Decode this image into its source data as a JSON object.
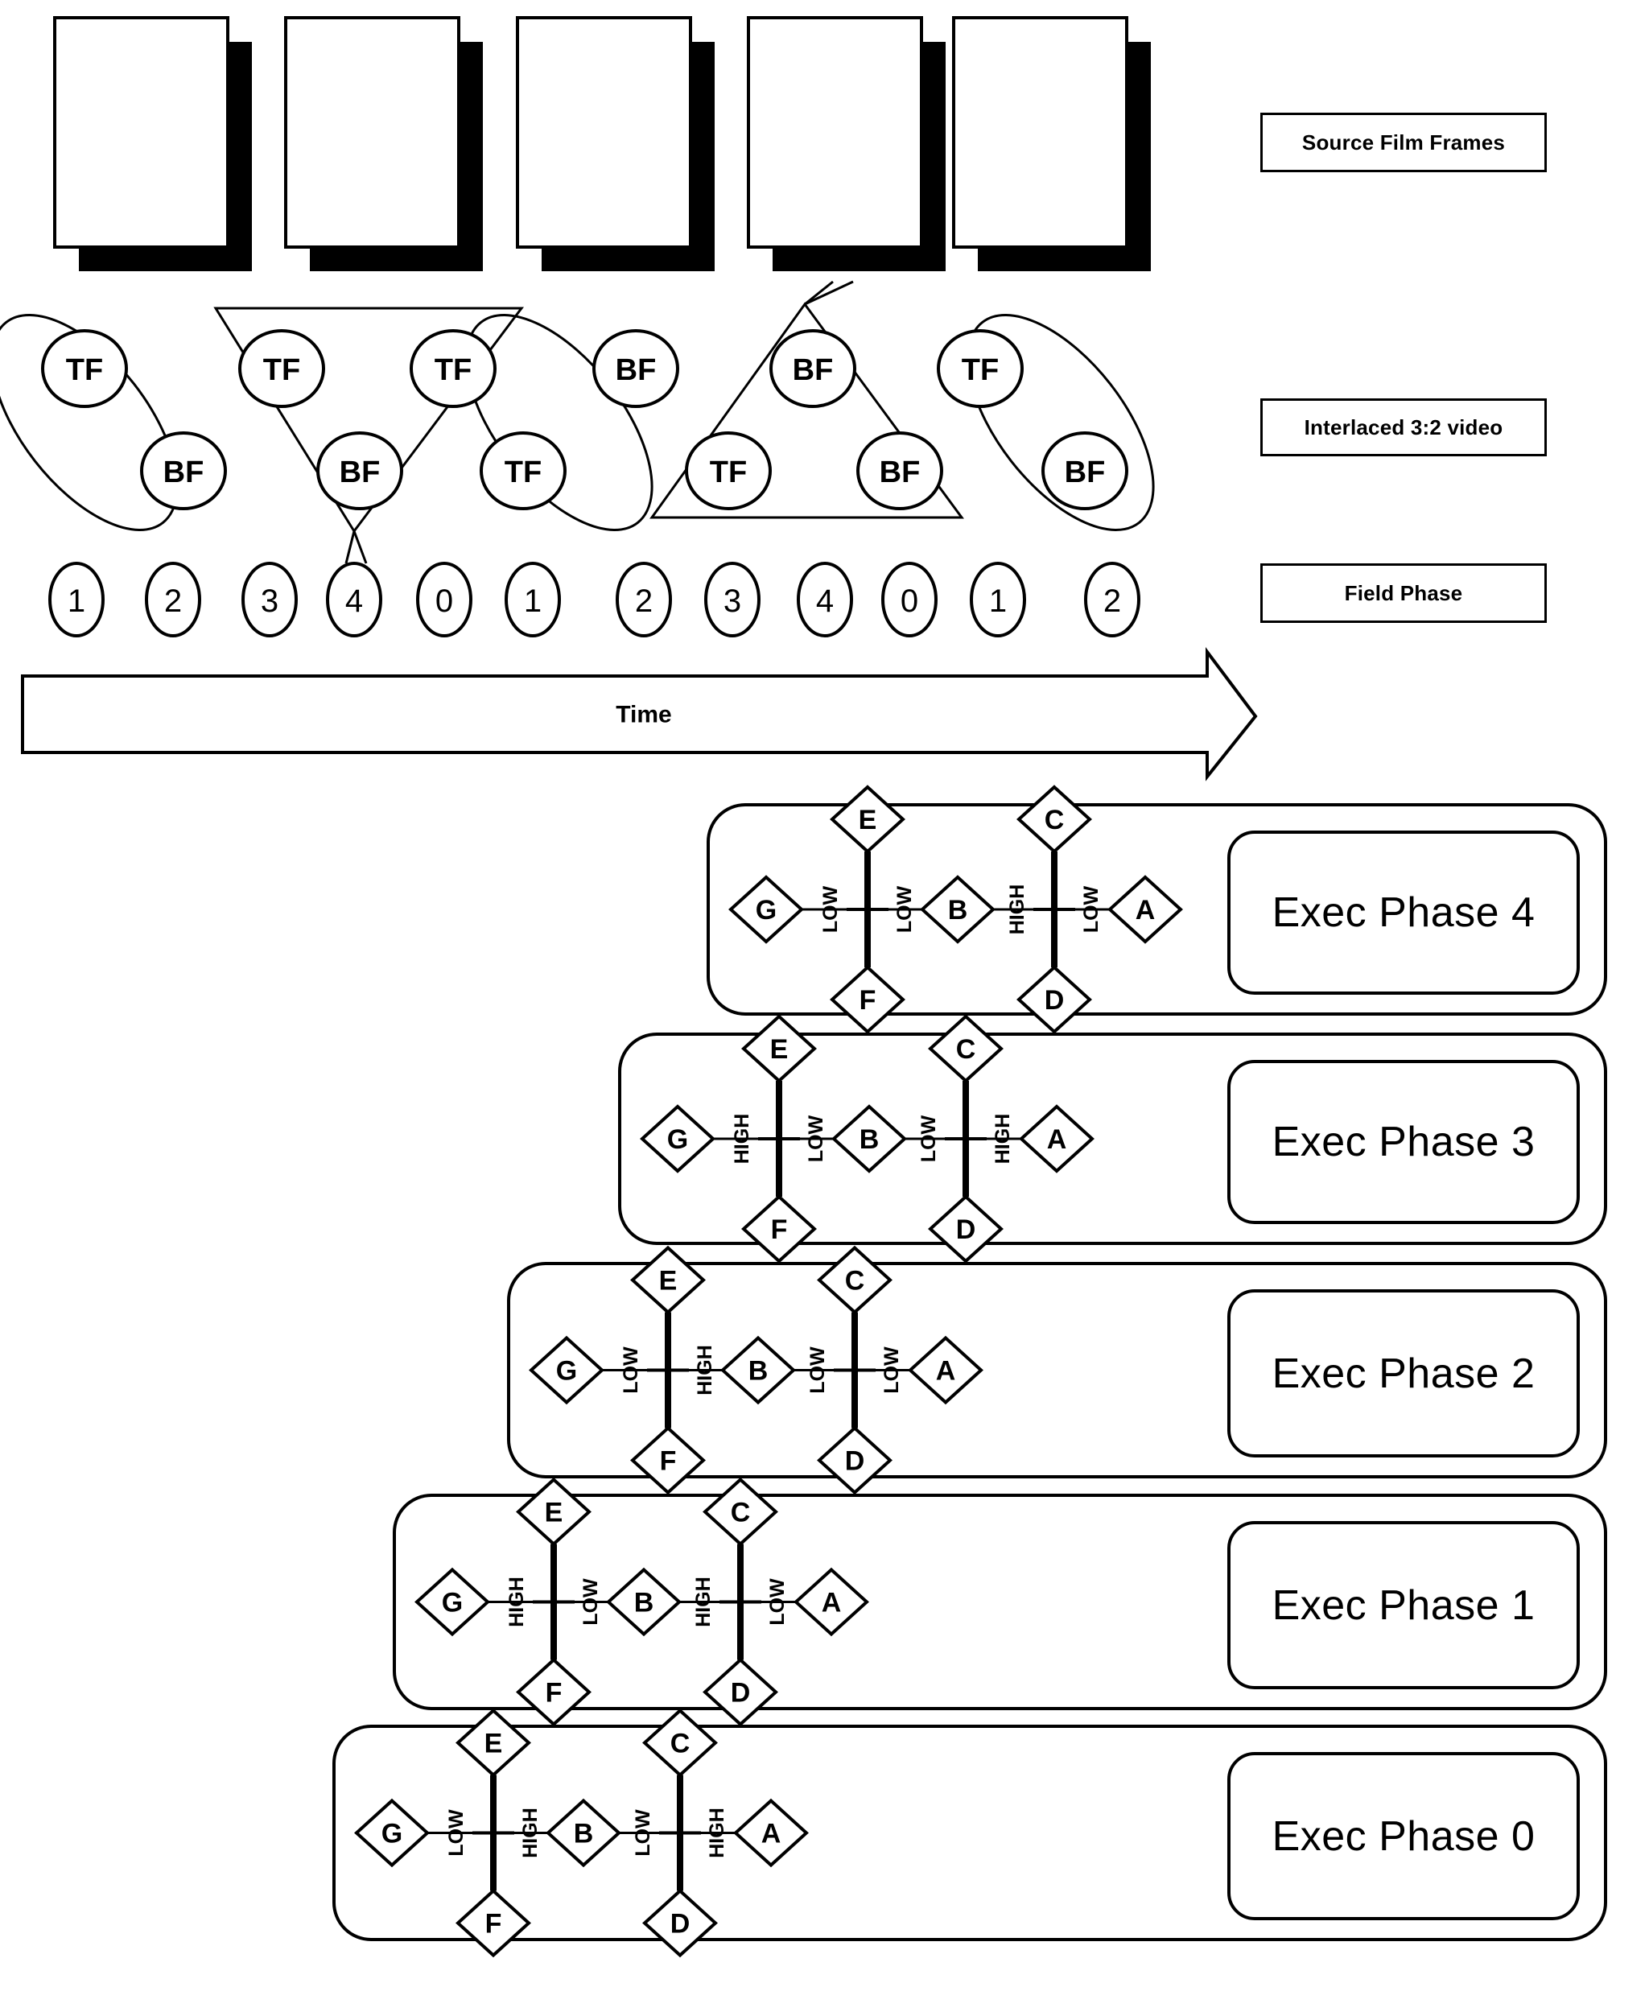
{
  "legend": {
    "source_film_frames": "Source Film Frames",
    "interlaced_video": "Interlaced 3:2 video",
    "field_phase": "Field Phase"
  },
  "time_axis": {
    "label": "Time"
  },
  "film_frames": {
    "count": 5,
    "labels": [
      "",
      "",
      "",
      "",
      ""
    ]
  },
  "interlaced_row": {
    "fields": [
      "TF",
      "BF",
      "TF",
      "BF",
      "TF",
      "TF",
      "BF",
      "TF",
      "BF",
      "BF",
      "TF",
      "BF"
    ],
    "group_shapes": [
      "ellipse",
      "triangle-down",
      "ellipse",
      "triangle-up",
      "ellipse"
    ],
    "group_members": [
      [
        "TF",
        "BF"
      ],
      [
        "TF",
        "TF",
        "BF"
      ],
      [
        "TF",
        "BF"
      ],
      [
        "TF",
        "BF",
        "BF"
      ],
      [
        "TF",
        "BF"
      ]
    ]
  },
  "field_phase_row": {
    "values": [
      "1",
      "2",
      "3",
      "4",
      "0",
      "1",
      "2",
      "3",
      "4",
      "0",
      "1",
      "2"
    ]
  },
  "exec_phases": [
    {
      "label": "Exec Phase 4",
      "nodes": {
        "left": "G",
        "top1": "E",
        "bottom1": "F",
        "middle": "B",
        "top2": "C",
        "bottom2": "D",
        "right": "A"
      },
      "edges": {
        "g_to_x1": "LOW",
        "x1_to_b": "LOW",
        "b_to_x2": "HIGH",
        "x2_to_a": "LOW"
      }
    },
    {
      "label": "Exec Phase 3",
      "nodes": {
        "left": "G",
        "top1": "E",
        "bottom1": "F",
        "middle": "B",
        "top2": "C",
        "bottom2": "D",
        "right": "A"
      },
      "edges": {
        "g_to_x1": "HIGH",
        "x1_to_b": "LOW",
        "b_to_x2": "LOW",
        "x2_to_a": "HIGH"
      }
    },
    {
      "label": "Exec Phase 2",
      "nodes": {
        "left": "G",
        "top1": "E",
        "bottom1": "F",
        "middle": "B",
        "top2": "C",
        "bottom2": "D",
        "right": "A"
      },
      "edges": {
        "g_to_x1": "LOW",
        "x1_to_b": "HIGH",
        "b_to_x2": "LOW",
        "x2_to_a": "LOW"
      }
    },
    {
      "label": "Exec Phase 1",
      "nodes": {
        "left": "G",
        "top1": "E",
        "bottom1": "F",
        "middle": "B",
        "top2": "C",
        "bottom2": "D",
        "right": "A"
      },
      "edges": {
        "g_to_x1": "HIGH",
        "x1_to_b": "LOW",
        "b_to_x2": "HIGH",
        "x2_to_a": "LOW"
      }
    },
    {
      "label": "Exec Phase 0",
      "nodes": {
        "left": "G",
        "top1": "E",
        "bottom1": "F",
        "middle": "B",
        "top2": "C",
        "bottom2": "D",
        "right": "A"
      },
      "edges": {
        "g_to_x1": "LOW",
        "x1_to_b": "HIGH",
        "b_to_x2": "LOW",
        "x2_to_a": "HIGH"
      }
    }
  ],
  "colors": {
    "ink": "#000000",
    "paper": "#ffffff"
  }
}
